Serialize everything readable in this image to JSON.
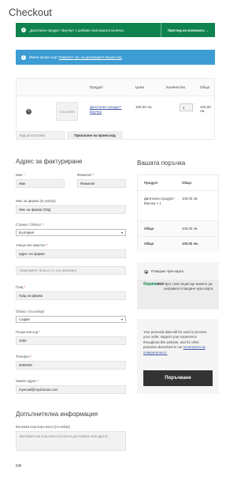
{
  "page": {
    "title": "Checkout"
  },
  "notices": {
    "added": {
      "message": "„Дигитален продукт: Ваучер“ е добавен във вашата количка.",
      "button": "Преглед на количката →"
    },
    "coupon": {
      "prefix": "Имате промо код?",
      "link": "Кликнете тук, за да въведете вашия код"
    }
  },
  "cart": {
    "headers": {
      "product": "Продукт",
      "price": "Цена",
      "quantity": "Количество",
      "total": "Общо"
    },
    "item": {
      "thumb": "VOUCHER",
      "name": "Дигитален продукт: Ваучер",
      "price": "100,00 лв.",
      "quantity": "1",
      "total": "100,00 лв."
    },
    "coupon_placeholder": "Код за отстъпка",
    "apply_label": "Прилагане на промо код"
  },
  "billing": {
    "heading": "Адрес за фактуриране",
    "first_name": {
      "label": "Име",
      "value": "Име"
    },
    "last_name": {
      "label": "Фамилия",
      "value": "Фамилия"
    },
    "company": {
      "label": "Име на фирма (по избор)",
      "value": "Име на фирма ООД"
    },
    "country": {
      "label": "Страна / Област",
      "value": "България"
    },
    "street": {
      "label": "Улица или квартал",
      "value": "адрес на фирма"
    },
    "apartment": {
      "placeholder": "Апартамент, блок и т.н. (по желание)"
    },
    "city": {
      "label": "Град",
      "value": "Град на фирма"
    },
    "region": {
      "label": "Област (по избор)",
      "value": "София"
    },
    "postcode": {
      "label": "Пощенски код",
      "value": "1000"
    },
    "phone": {
      "label": "Телефон",
      "value": "0000000"
    },
    "email": {
      "label": "Имейл адрес",
      "value": "myemail@mydomain.com"
    }
  },
  "additional": {
    "heading": "Допълнителна информация",
    "notes_label": "Бележки към поръчката (по избор)",
    "notes_placeholder": "Бележки към поръчката (относно доставката или друго)."
  },
  "edit_link": "Edit",
  "order": {
    "heading": "Вашата поръчка",
    "col_product": "Продукт",
    "col_total": "Общо",
    "line_name": "Дигитален продукт: Ваучер × 1",
    "line_total": "100,00 лв.",
    "subtotal_label": "Общо",
    "subtotal_value": "100,00 лв.",
    "total_label": "Общо",
    "total_value": "100,00 лв."
  },
  "payment": {
    "method": "Плащане чрез карта",
    "brand": "борика",
    "brand_suffix": "вск",
    "description": "Чрез тази опция ще можете да направите плащане чрез карта"
  },
  "privacy": {
    "text": "Your personal data will be used to process your order, support your experience throughout this website, and for other purposes described in our",
    "link": "политиката за поверителност.",
    "place_order": "Поръчване"
  },
  "colors": {
    "success": "#0f834d",
    "info": "#3d9cd2",
    "dark": "#333333"
  }
}
